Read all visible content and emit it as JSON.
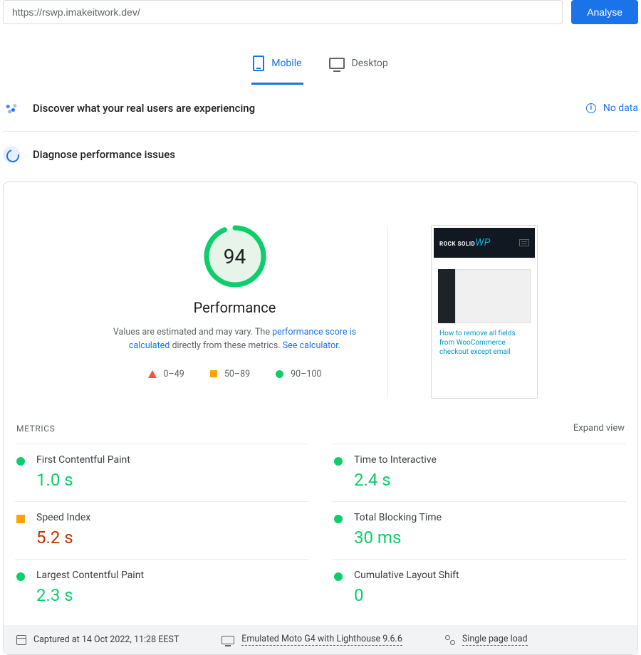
{
  "url_input": {
    "value": "https://rswp.imakeitwork.dev/"
  },
  "analyse_button": "Analyse",
  "tabs": {
    "mobile": "Mobile",
    "desktop": "Desktop",
    "active": "mobile"
  },
  "crux_section": {
    "title": "Discover what your real users are experiencing",
    "no_data": "No data"
  },
  "lh_section": {
    "title": "Diagnose performance issues"
  },
  "gauge": {
    "score": "94",
    "label": "Performance"
  },
  "perf_note": {
    "pre": "Values are estimated and may vary. The ",
    "link1": "performance score is calculated",
    "mid": " directly from these metrics. ",
    "link2": "See calculator."
  },
  "ranges": {
    "bad": "0–49",
    "mid": "50–89",
    "good": "90–100"
  },
  "screenshot": {
    "logo_pre": "ROCK SOLID",
    "logo_wp": "WP",
    "text": "How to remove all fields from WooCommerce checkout except email"
  },
  "metrics_header": "METRICS",
  "expand_view": "Expand view",
  "metrics": [
    {
      "label": "First Contentful Paint",
      "value": "1.0 s",
      "status": "g"
    },
    {
      "label": "Time to Interactive",
      "value": "2.4 s",
      "status": "g"
    },
    {
      "label": "Speed Index",
      "value": "5.2 s",
      "status": "o"
    },
    {
      "label": "Total Blocking Time",
      "value": "30 ms",
      "status": "g"
    },
    {
      "label": "Largest Contentful Paint",
      "value": "2.3 s",
      "status": "g"
    },
    {
      "label": "Cumulative Layout Shift",
      "value": "0",
      "status": "g"
    }
  ],
  "footer": {
    "captured": "Captured at 14 Oct 2022, 11:28 EEST",
    "emulated": "Emulated Moto G4 with Lighthouse 9.6.6",
    "load": "Single page load"
  },
  "chart_data": {
    "type": "gauge",
    "value": 94,
    "range": [
      0,
      100
    ],
    "thresholds": [
      {
        "label": "bad",
        "min": 0,
        "max": 49,
        "color": "#ff4e42"
      },
      {
        "label": "mid",
        "min": 50,
        "max": 89,
        "color": "#ffa400"
      },
      {
        "label": "good",
        "min": 90,
        "max": 100,
        "color": "#0cce6b"
      }
    ],
    "title": "Performance"
  }
}
